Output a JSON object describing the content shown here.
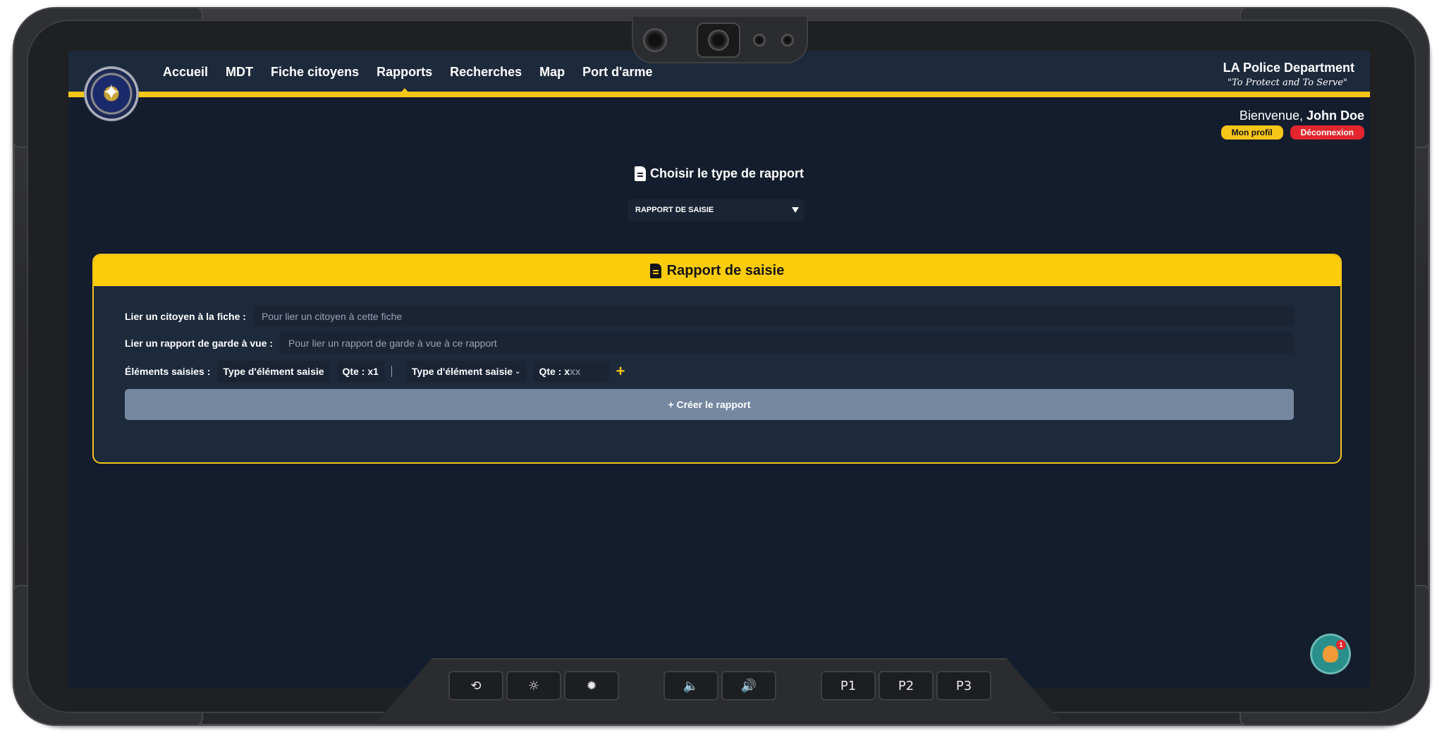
{
  "nav": {
    "links": [
      "Accueil",
      "MDT",
      "Fiche citoyens",
      "Rapports",
      "Recherches",
      "Map",
      "Port d'arme"
    ],
    "active": "Rapports"
  },
  "department": {
    "name": "LA Police Department",
    "motto": "\"To Protect and To Serve\""
  },
  "user": {
    "greeting": "Bienvenue,",
    "name": "John Doe",
    "profile_label": "Mon profil",
    "logout_label": "Déconnexion"
  },
  "report_type": {
    "title": "Choisir le type de rapport",
    "selected": "RAPPORT DE SAISIE"
  },
  "report_panel": {
    "title": "Rapport de saisie",
    "citizen_label": "Lier un citoyen à la fiche :",
    "citizen_placeholder": "Pour lier un citoyen à cette fiche",
    "custody_label": "Lier un rapport de garde à vue :",
    "custody_placeholder": "Pour lier un rapport de garde à vue à ce rapport",
    "items_label": "Éléments saisies :",
    "item1_type": "Type d'élément saisie",
    "item1_qty": "Qte : x1",
    "item2_type": "Type d'élément saisie",
    "item2_qty_prefix": "Qte : x",
    "item2_qty_placeholder": "xx",
    "add_symbol": "+",
    "create_label": "+ Créer le rapport"
  },
  "notification": {
    "count": "1"
  },
  "hardware": {
    "group1": [
      "⟲",
      "☼",
      "✹"
    ],
    "group2": [
      "🔈",
      "🔊"
    ],
    "group3": [
      "P1",
      "P2",
      "P3"
    ]
  },
  "colors": {
    "accent": "#f5c518",
    "danger": "#e3262e",
    "screen_bg": "#141d2d",
    "panel_bg": "#1d2a3c"
  }
}
